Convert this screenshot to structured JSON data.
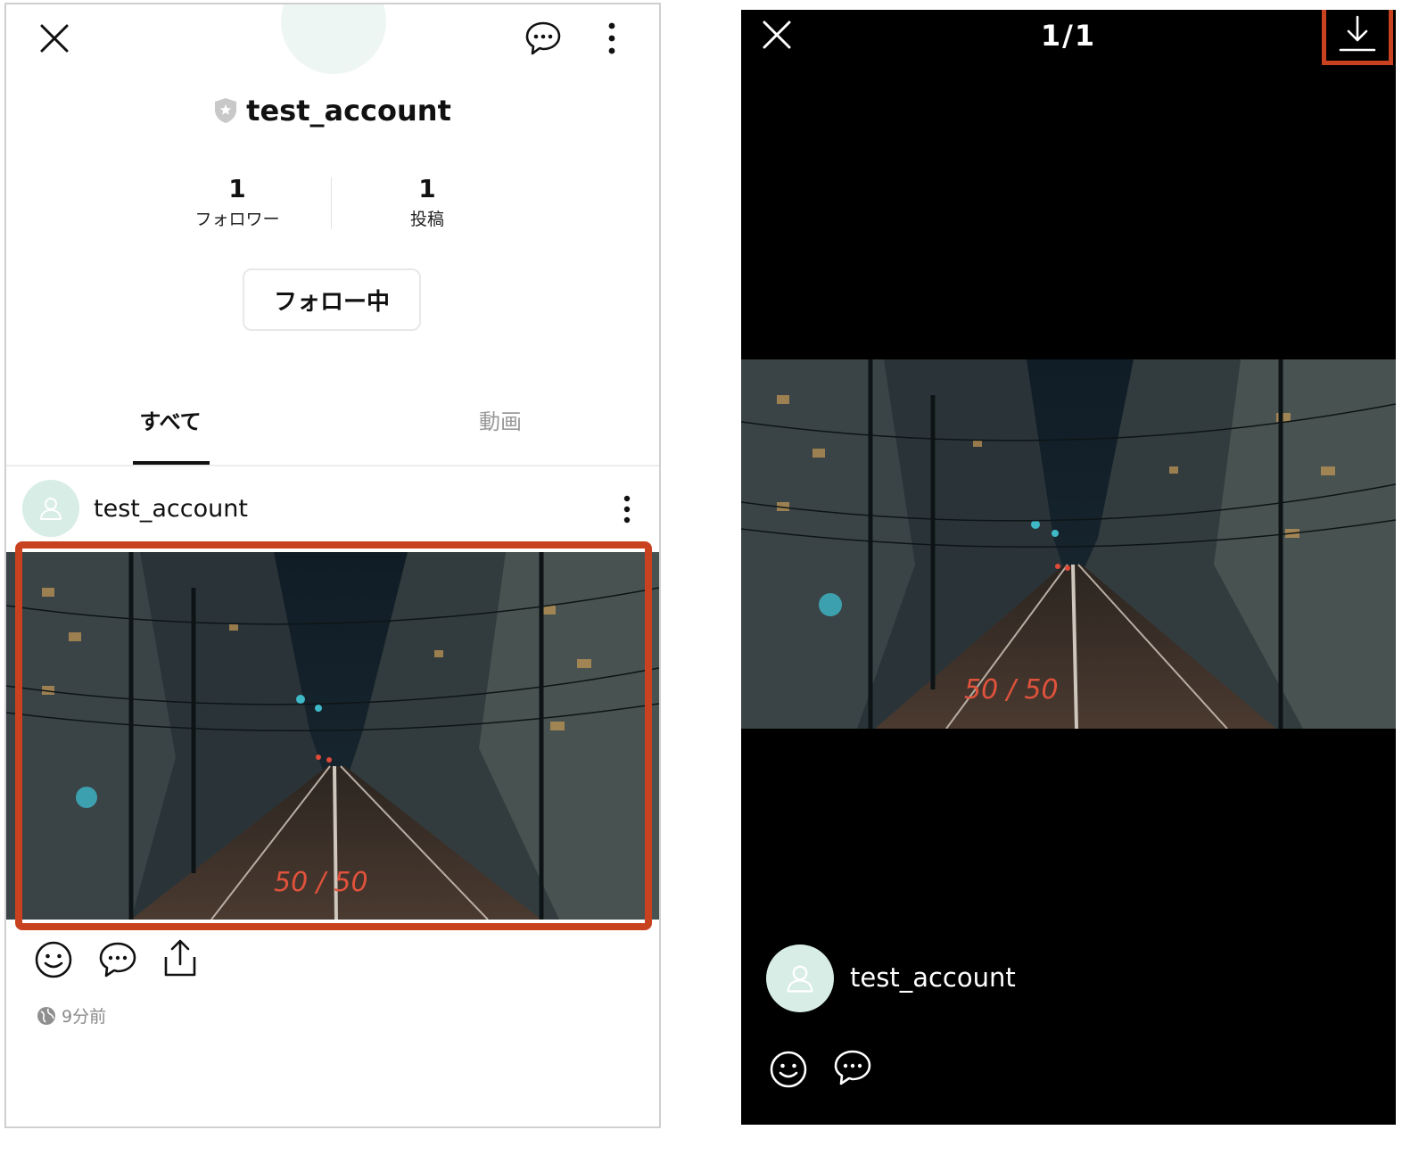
{
  "profile": {
    "username": "test_account",
    "stats": [
      {
        "value": "1",
        "label": "フォロワー"
      },
      {
        "value": "1",
        "label": "投稿"
      }
    ],
    "follow_button": "フォロー中",
    "tabs": [
      {
        "label": "すべて",
        "active": true
      },
      {
        "label": "動画",
        "active": false
      }
    ]
  },
  "post": {
    "username": "test_account",
    "time": "9分前",
    "road_marking": "50 / 50"
  },
  "viewer": {
    "counter": "1/1",
    "username": "test_account"
  },
  "colors": {
    "highlight": "#c9421f",
    "avatar_bg": "#d7ede6",
    "viewer_bg": "#000000"
  },
  "icons": [
    "close-icon",
    "chat-bubble-icon",
    "more-vertical-icon",
    "shield-star-icon",
    "user-icon",
    "smiley-icon",
    "share-icon",
    "globe-icon",
    "download-icon"
  ]
}
